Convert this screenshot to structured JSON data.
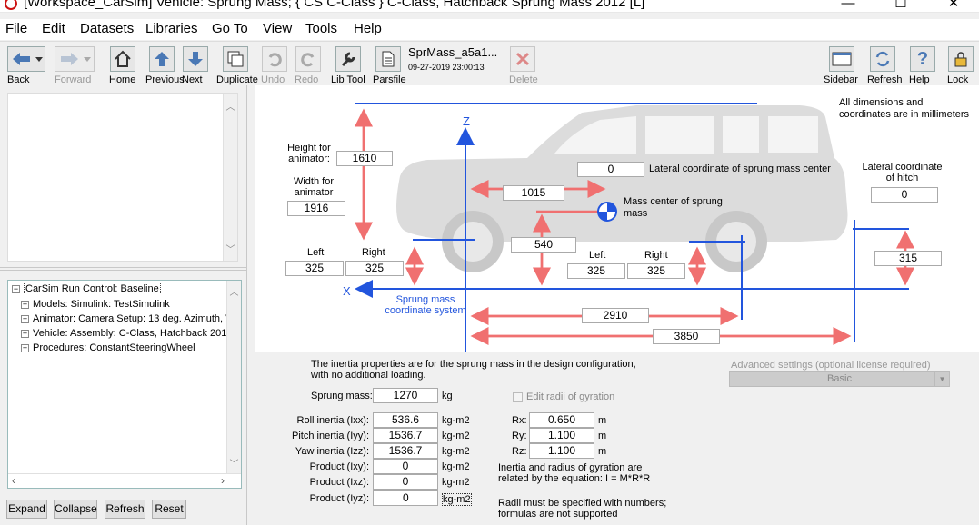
{
  "window": {
    "title": "[Workspace_CarSim] Vehicle: Sprung Mass; { CS C-Class } C-Class, Hatchback Sprung Mass 2012 [L]",
    "minimize": "—",
    "maximize": "☐",
    "close": "✕"
  },
  "menu": [
    "File",
    "Edit",
    "Datasets",
    "Libraries",
    "Go To",
    "View",
    "Tools",
    "Help"
  ],
  "toolbar": {
    "back": "Back",
    "forward": "Forward",
    "home": "Home",
    "previous": "Previous",
    "next": "Next",
    "duplicate": "Duplicate",
    "undo": "Undo",
    "redo": "Redo",
    "lib_tool": "Lib Tool",
    "parsfile": "Parsfile",
    "dataset_name": "SprMass_a5a1...",
    "dataset_date": "09-27-2019 23:00:13",
    "delete": "Delete",
    "sidebar": "Sidebar",
    "refresh": "Refresh",
    "help": "Help",
    "lock": "Lock"
  },
  "tree": {
    "root": "CarSim Run Control: Baseline",
    "items": [
      "Models: Simulink: TestSimulink",
      "Animator: Camera Setup: 13 deg. Azimuth, V",
      "Vehicle: Assembly: C-Class, Hatchback 201",
      "Procedures: ConstantSteeringWheel"
    ]
  },
  "left_buttons": {
    "expand": "Expand",
    "collapse": "Collapse",
    "refresh": "Refresh",
    "reset": "Reset"
  },
  "diagram": {
    "note": "All dimensions and coordinates are in millimeters",
    "height_label": "Height for animator:",
    "height_value": "1610",
    "width_label": "Width for animator",
    "width_value": "1916",
    "lateral_cg_label": "Lateral coordinate of sprung mass center",
    "lateral_cg_value": "0",
    "lateral_hitch_label": "Lateral coordinate of hitch",
    "lateral_hitch_value": "0",
    "cg_x_value": "1015",
    "cg_label": "Mass center of sprung mass",
    "cg_height_value": "540",
    "front_left_label": "Left",
    "front_right_label": "Right",
    "front_left_value": "325",
    "front_right_value": "325",
    "rear_left_label": "Left",
    "rear_right_label": "Right",
    "rear_left_value": "325",
    "rear_right_value": "325",
    "hitch_height_value": "315",
    "wheelbase_value": "2910",
    "hitch_x_value": "3850",
    "coord_label": "Sprung mass coordinate system",
    "z_axis": "Z",
    "x_axis": "X"
  },
  "properties": {
    "note": "The inertia properties are for the sprung mass in the design configuration, with no additional loading.",
    "sprung_mass_label": "Sprung mass:",
    "sprung_mass_value": "1270",
    "sprung_mass_unit": "kg",
    "roll_label": "Roll inertia (Ixx):",
    "roll_value": "536.6",
    "pitch_label": "Pitch inertia (Iyy):",
    "pitch_value": "1536.7",
    "yaw_label": "Yaw inertia (Izz):",
    "yaw_value": "1536.7",
    "ixy_label": "Product (Ixy):",
    "ixy_value": "0",
    "ixz_label": "Product (Ixz):",
    "ixz_value": "0",
    "iyz_label": "Product (Iyz):",
    "iyz_value": "0",
    "inertia_unit": "kg-m2",
    "edit_radii_label": "Edit radii of gyration",
    "rx_label": "Rx:",
    "rx_value": "0.650",
    "ry_label": "Ry:",
    "ry_value": "1.100",
    "rz_label": "Rz:",
    "rz_value": "1.100",
    "radius_unit": "m",
    "relation_note": "Inertia and radius of gyration are related by the equation: I = M*R*R",
    "radii_note": "Radii must be specified with numbers; formulas are not supported"
  },
  "advanced": {
    "label": "Advanced settings (optional license required)",
    "value": "Basic"
  }
}
